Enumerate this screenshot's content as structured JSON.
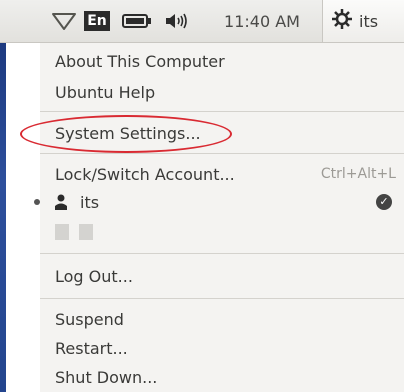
{
  "panel": {
    "keyboard_layout": "En",
    "clock": "11:40 AM",
    "username": "its",
    "icons": [
      "wifi-icon",
      "battery-icon",
      "volume-icon",
      "session-gear-icon"
    ]
  },
  "menu": {
    "items": [
      {
        "label": "About This Computer"
      },
      {
        "label": "Ubuntu Help"
      },
      {
        "label": "System Settings..."
      },
      {
        "label": "Lock/Switch Account...",
        "shortcut": "Ctrl+Alt+L"
      },
      {
        "label": "its",
        "active": true
      },
      {
        "label": "Log Out..."
      },
      {
        "label": "Suspend"
      },
      {
        "label": "Restart..."
      },
      {
        "label": "Shut Down..."
      }
    ]
  },
  "colors": {
    "panel_bg": "#e8e7e3",
    "menu_bg": "#f4f3f1",
    "highlight_ring": "#d92a32",
    "left_bar": "#2d4f9c"
  }
}
